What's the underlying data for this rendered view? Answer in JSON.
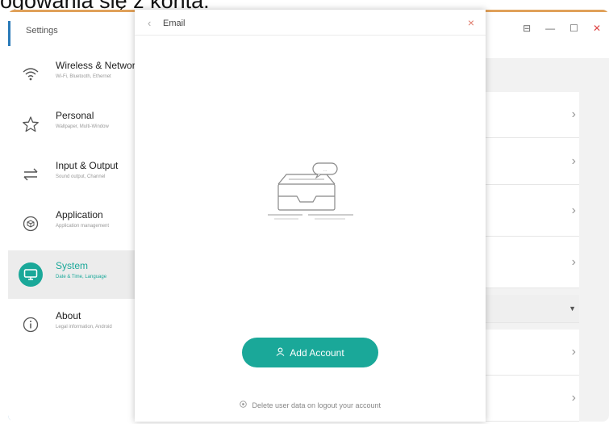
{
  "caption": "ogowania się z konta.",
  "settings": {
    "title": "Settings",
    "window_controls": [
      "⊟",
      "—",
      "☐",
      "✕"
    ],
    "sidebar": [
      {
        "label": "Wireless & Network",
        "sub": "Wi-Fi, Bluetooth, Ethernet",
        "icon": "wifi-icon",
        "active": false
      },
      {
        "label": "Personal",
        "sub": "Wallpaper, Multi-Window",
        "icon": "star-icon",
        "active": false
      },
      {
        "label": "Input & Output",
        "sub": "Sound output, Channel",
        "icon": "swap-icon",
        "active": false
      },
      {
        "label": "Application",
        "sub": "Application management",
        "icon": "cube-icon",
        "active": false
      },
      {
        "label": "System",
        "sub": "Date & Time, Language",
        "icon": "monitor-icon",
        "active": true
      },
      {
        "label": "About",
        "sub": "Legal information, Android",
        "icon": "info-icon",
        "active": false
      }
    ],
    "chevron": "›",
    "caret": "▼"
  },
  "dialog": {
    "back": "‹",
    "title": "Email",
    "close": "×",
    "illustration_badge": "...",
    "add_account_label": "Add Account",
    "footer_note": "Delete user data on logout your account"
  },
  "colors": {
    "accent": "#1aa899",
    "close": "#e07a6a"
  }
}
